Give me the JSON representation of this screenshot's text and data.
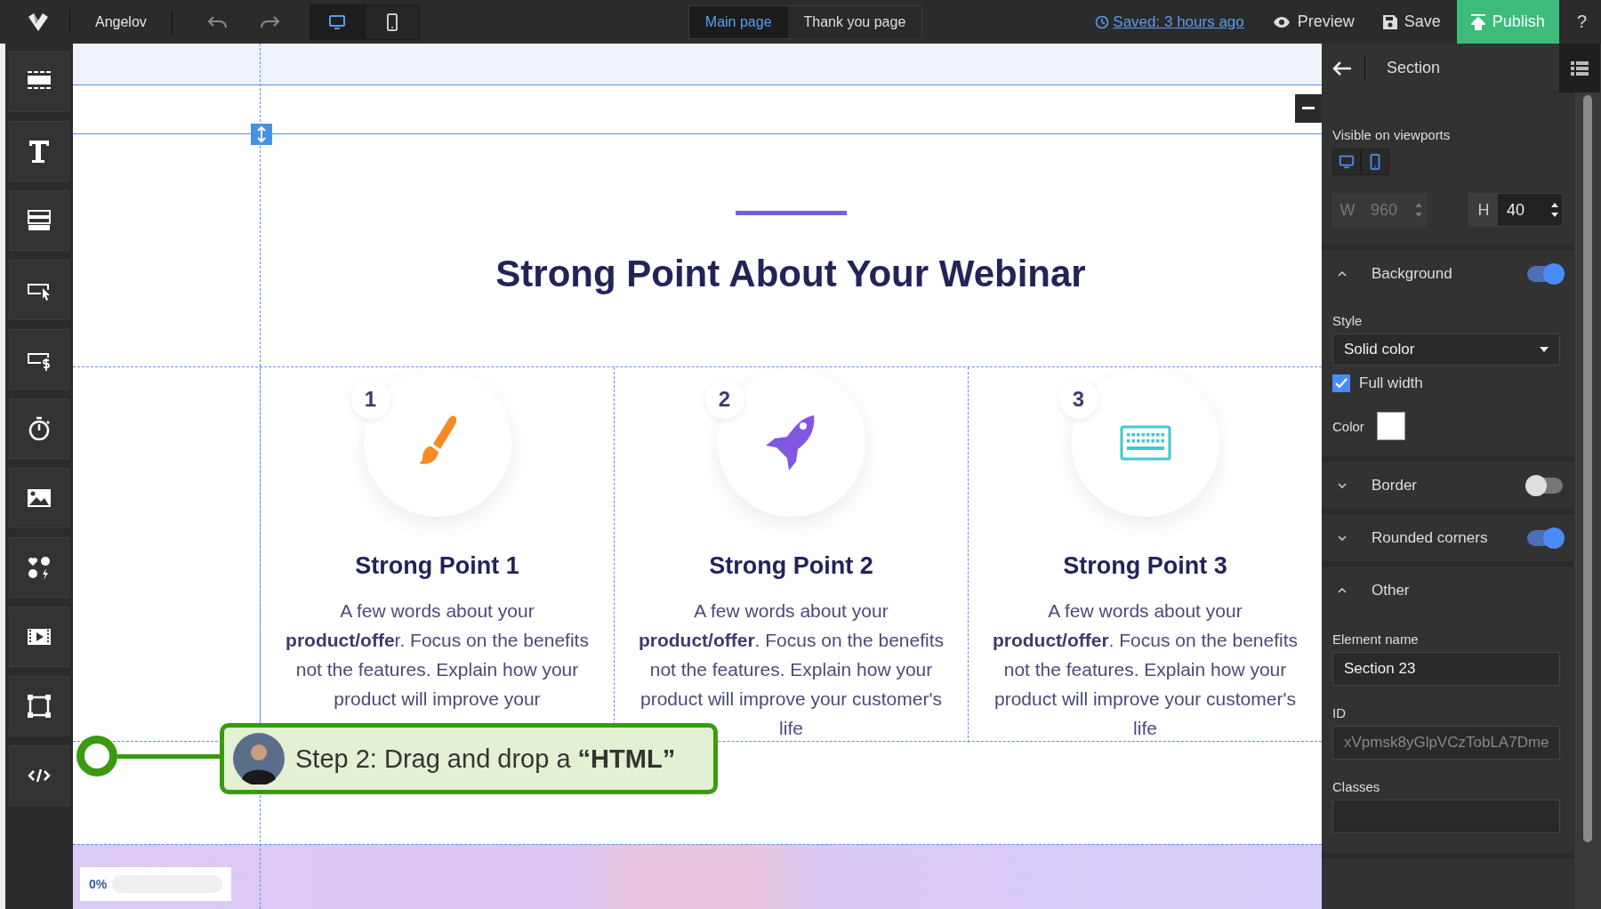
{
  "top_bar": {
    "project": "Angelov",
    "viewports": [
      {
        "kind": "desktop",
        "selected": true
      },
      {
        "kind": "mobile",
        "selected": false
      }
    ],
    "pages": [
      {
        "label": "Main page",
        "selected": true
      },
      {
        "label": "Thank you page",
        "selected": false
      }
    ],
    "saved": "Saved: 3 hours ago",
    "preview": "Preview",
    "save": "Save",
    "publish": "Publish",
    "help": "?"
  },
  "canvas": {
    "headline": "Strong Point About Your Webinar",
    "points": [
      {
        "number": "1",
        "kind": "brush",
        "title": "Strong Point 1",
        "text": "A few words about your **product/offe**r. Focus on the benefits not the features. Explain how your product will improve your"
      },
      {
        "number": "2",
        "kind": "rocket",
        "title": "Strong Point 2",
        "text": "A few words about your **product/offer**. Focus on the benefits not the features. Explain how your product will improve your customer's life"
      },
      {
        "number": "3",
        "kind": "keyboard",
        "title": "Strong Point 3",
        "text": "A few words about your **product/offer**. Focus on the benefits not the features. Explain how your product will improve your customer's life"
      }
    ],
    "progress": {
      "label": "0%",
      "level": 0
    }
  },
  "tooltip": {
    "text": "Step 2: Drag and drop a **“HTML”**"
  },
  "panel": {
    "title": "Section",
    "viewports_label": "Visible on viewports",
    "viewports": [
      {
        "kind": "desktop",
        "selected": true
      },
      {
        "kind": "mobile",
        "selected": true
      }
    ],
    "width": {
      "label": "W",
      "value": "960",
      "disabled": true
    },
    "height": {
      "label": "H",
      "value": "40",
      "disabled": false
    },
    "sections": [
      {
        "kind": "background",
        "label": "Background",
        "expanded": true,
        "on": true,
        "style_label": "Style",
        "style": "Solid color",
        "full_width": {
          "label": "Full width",
          "checked": true
        },
        "color_label": "Color",
        "color": "#ffffff"
      },
      {
        "kind": "toggle",
        "label": "Border",
        "expanded": false,
        "on": false
      },
      {
        "kind": "toggle",
        "label": "Rounded corners",
        "expanded": false,
        "on": true
      },
      {
        "kind": "other",
        "label": "Other",
        "expanded": true,
        "element_name_label": "Element name",
        "element_name": "Section 23",
        "id_label": "ID",
        "id": "xVpmsk8yGlpVCzTobLA7Dme",
        "classes_label": "Classes"
      }
    ]
  }
}
